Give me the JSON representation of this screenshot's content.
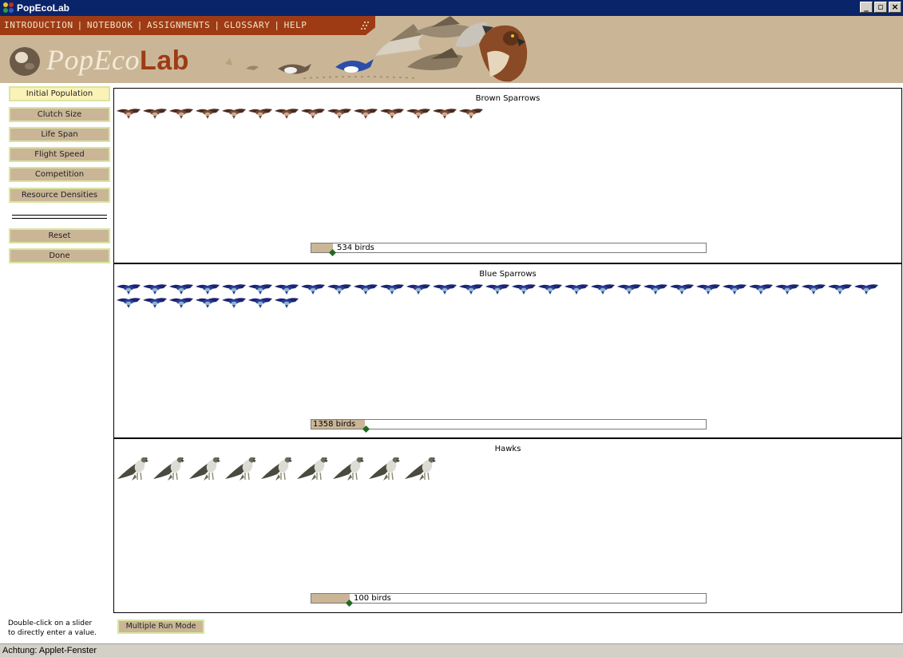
{
  "window": {
    "title": "PopEcoLab",
    "controls": {
      "minimize": "_",
      "maximize": "▫",
      "close": "×"
    }
  },
  "header": {
    "menu": [
      "INTRODUCTION",
      "NOTEBOOK",
      "ASSIGNMENTS",
      "GLOSSARY",
      "HELP"
    ],
    "menu_separator": "|",
    "logo_regular": "PopEco",
    "logo_bold": "Lab"
  },
  "sidebar": {
    "items": [
      {
        "label": "Initial Population",
        "active": true
      },
      {
        "label": "Clutch Size",
        "active": false
      },
      {
        "label": "Life Span",
        "active": false
      },
      {
        "label": "Flight Speed",
        "active": false
      },
      {
        "label": "Competition",
        "active": false
      },
      {
        "label": "Resource Densities",
        "active": false
      }
    ],
    "actions": [
      {
        "label": "Reset"
      },
      {
        "label": "Done"
      }
    ]
  },
  "panels": [
    {
      "title": "Brown Sparrows",
      "slider_label": "534 birds",
      "slider_fraction": 0.055,
      "icon_count": 14,
      "species": "brown",
      "colors": {
        "body": "#7a4a35",
        "wing": "#4a2b1f",
        "breast": "#c9a894"
      }
    },
    {
      "title": "Blue Sparrows",
      "slider_label": "1358 birds",
      "slider_fraction": 0.135,
      "icon_count": 36,
      "species": "blue",
      "colors": {
        "body": "#2e3d9c",
        "wing": "#1a2470",
        "breast": "#8fb6c8"
      }
    },
    {
      "title": "Hawks",
      "slider_label": "100 birds",
      "slider_fraction": 0.097,
      "icon_count": 9,
      "species": "hawk",
      "colors": {
        "body": "#6b6a5c",
        "wing": "#4a4b40",
        "breast": "#dcdcd4"
      }
    }
  ],
  "colors": {
    "accent": "#cab697",
    "menu_bar": "#9e3b14",
    "thumb": "#1f6b1f",
    "title_bar": "#0a246a"
  },
  "footer": {
    "hint_line1": "Double-click on a slider",
    "hint_line2": "to directly enter a value.",
    "multiple_run_label": "Multiple Run Mode",
    "status": "Achtung: Applet-Fenster"
  }
}
